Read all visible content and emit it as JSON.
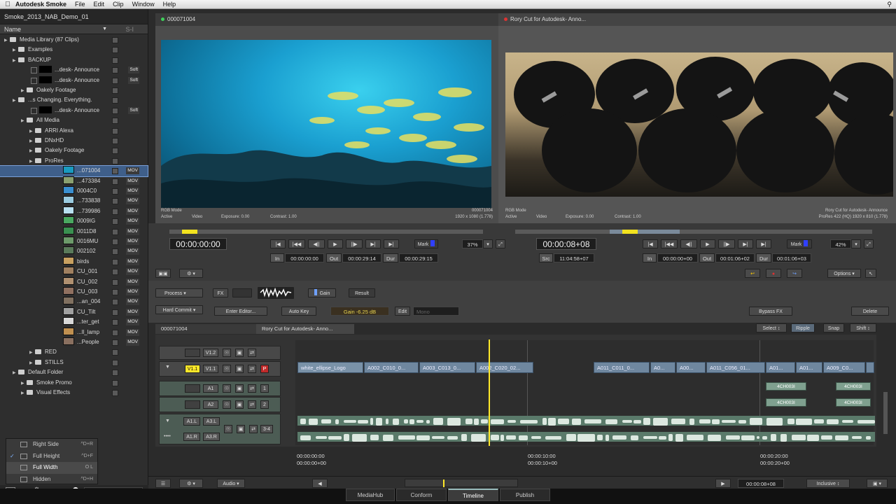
{
  "menubar": {
    "app": "Autodesk Smoke",
    "items": [
      "File",
      "Edit",
      "Clip",
      "Window",
      "Help"
    ]
  },
  "library": {
    "project_title": "Smoke_2013_NAB_Demo_01",
    "col_name": "Name",
    "col_si": "S-I",
    "rows": [
      {
        "label": "Media Library (87 Clips)",
        "indent": 0,
        "type": "root"
      },
      {
        "label": "Examples",
        "indent": 1,
        "type": "folder"
      },
      {
        "label": "BACKUP",
        "indent": 1,
        "type": "folder"
      },
      {
        "label": "...desk- Announce",
        "indent": 2,
        "type": "seq",
        "tag": "Soft"
      },
      {
        "label": "...desk- Announce",
        "indent": 2,
        "type": "seq",
        "tag": "Soft"
      },
      {
        "label": "Oakely Footage",
        "indent": 2,
        "type": "folder"
      },
      {
        "label": "...s Changing. Everything.",
        "indent": 1,
        "type": "folder"
      },
      {
        "label": "...desk- Announce",
        "indent": 2,
        "type": "seq",
        "tag": "Soft"
      },
      {
        "label": "All Media",
        "indent": 2,
        "type": "folder"
      },
      {
        "label": "ARRI Alexa",
        "indent": 3,
        "type": "folder"
      },
      {
        "label": "DNxHD",
        "indent": 3,
        "type": "folder"
      },
      {
        "label": "Oakely Footage",
        "indent": 3,
        "type": "folder"
      },
      {
        "label": "ProRes",
        "indent": 3,
        "type": "folder"
      },
      {
        "label": "...071004",
        "indent": 4,
        "type": "clip",
        "tag": "MOV",
        "color": "#1a9bc0",
        "selected": true
      },
      {
        "label": "...473384",
        "indent": 4,
        "type": "clip",
        "tag": "MOV",
        "color": "#8aa070"
      },
      {
        "label": "0004C0",
        "indent": 4,
        "type": "clip",
        "tag": "MOV",
        "color": "#3a8fd0"
      },
      {
        "label": "...733838",
        "indent": 4,
        "type": "clip",
        "tag": "MOV",
        "color": "#9acbe0"
      },
      {
        "label": "...739986",
        "indent": 4,
        "type": "clip",
        "tag": "MOV",
        "color": "#b8dff0"
      },
      {
        "label": "0009IG",
        "indent": 4,
        "type": "clip",
        "tag": "MOV",
        "color": "#4aa860"
      },
      {
        "label": "0011D8",
        "indent": 4,
        "type": "clip",
        "tag": "MOV",
        "color": "#3a9050"
      },
      {
        "label": "0016MU",
        "indent": 4,
        "type": "clip",
        "tag": "MOV",
        "color": "#6c9a6a"
      },
      {
        "label": "002102",
        "indent": 4,
        "type": "clip",
        "tag": "MOV",
        "color": "#5a7a5a"
      },
      {
        "label": "birds",
        "indent": 4,
        "type": "clip",
        "tag": "MOV",
        "color": "#c8a060"
      },
      {
        "label": "CU_001",
        "indent": 4,
        "type": "clip",
        "tag": "MOV",
        "color": "#a08060"
      },
      {
        "label": "CU_002",
        "indent": 4,
        "type": "clip",
        "tag": "MOV",
        "color": "#b09070"
      },
      {
        "label": "CU_003",
        "indent": 4,
        "type": "clip",
        "tag": "MOV",
        "color": "#907060"
      },
      {
        "label": "...an_004",
        "indent": 4,
        "type": "clip",
        "tag": "MOV",
        "color": "#807060"
      },
      {
        "label": "CU_Tilt",
        "indent": 4,
        "type": "clip",
        "tag": "MOV",
        "color": "#a0a0a0"
      },
      {
        "label": "...ter_get",
        "indent": 4,
        "type": "clip",
        "tag": "MOV",
        "color": "#d8d8d8"
      },
      {
        "label": "...ll_lamp",
        "indent": 4,
        "type": "clip",
        "tag": "MOV",
        "color": "#c09050"
      },
      {
        "label": "...People",
        "indent": 4,
        "type": "clip",
        "tag": "MOV",
        "color": "#8a7060"
      },
      {
        "label": "RED",
        "indent": 3,
        "type": "folder"
      },
      {
        "label": "STILLS",
        "indent": 3,
        "type": "folder"
      },
      {
        "label": "Default Folder",
        "indent": 1,
        "type": "folder"
      },
      {
        "label": "Smoke Promo",
        "indent": 2,
        "type": "folder"
      },
      {
        "label": "Visual Effects",
        "indent": 2,
        "type": "folder"
      }
    ]
  },
  "view_menu": [
    {
      "label": "Right Side",
      "shortcut": "^D+R"
    },
    {
      "label": "Full Height",
      "shortcut": "^D+F",
      "checked": true
    },
    {
      "label": "Full Width",
      "shortcut": "O L",
      "active": true
    },
    {
      "label": "Hidden",
      "shortcut": "^D+H"
    }
  ],
  "source_viewer": {
    "tab": "000071004",
    "meta_mode": "RGB Mode",
    "meta_active": "Active",
    "meta_video": "Video",
    "meta_exposure": "Exposure: 0.00",
    "meta_contrast": "Contrast: 1.00",
    "meta_name": "000071004",
    "meta_res": "1920 x 1080 (1.778)",
    "timecode": "00:00:00:00",
    "mark": "Mark",
    "zoom": "37%",
    "in_label": "In",
    "in_val": "00:00:00:00",
    "out_label": "Out",
    "out_val": "00:00:29:14",
    "dur_label": "Dur",
    "dur_val": "00:00:29:15",
    "scrub_pos": 0.04
  },
  "record_viewer": {
    "tab": "Rory Cut for Autodesk- Anno...",
    "meta_mode": "RGB Mode",
    "meta_active": "Active",
    "meta_video": "Video",
    "meta_exposure": "Exposure: 0.00",
    "meta_contrast": "Contrast: 1.00",
    "meta_name": "Rory Cut for Autodesk- Announce",
    "meta_res": "ProRes 422 (HQ) 1920 x 810 (1.778)",
    "timecode": "00:00:08+08",
    "mark": "Mark",
    "zoom": "42%",
    "src_label": "Src",
    "src_val": "11:04:58+07",
    "in_label": "In",
    "in_val": "00:00:00+00",
    "out_label": "Out",
    "out_val": "00:01:06+02",
    "dur_label": "Dur",
    "dur_val": "00:01:06+03",
    "scrub_pos": 0.3
  },
  "tools": {
    "options": "Options",
    "process": "Process",
    "fx": "FX",
    "gain": "Gain",
    "result": "Result",
    "hard_commit": "Hard Commit",
    "enter_editor": "Enter Editor...",
    "auto_key": "Auto Key",
    "gain_val": "Gain -6.25 dB",
    "edit": "Edit",
    "mono": "Mono",
    "bypass": "Bypass FX",
    "delete": "Delete"
  },
  "timeline": {
    "tab_source": "000071004",
    "tab_record": "Rory Cut for Autodesk- Anno...",
    "select": "Select",
    "ripple": "Ripple",
    "snap": "Snap",
    "shift": "Shift",
    "tracks": {
      "v12": "V1.2",
      "v11": "V1.1",
      "v11b": "V1.1",
      "p": "P",
      "a1": "A1",
      "a1n": "1",
      "a2": "A2",
      "a2n": "2",
      "a1l": "A1.L",
      "a3l": "A3.L",
      "a34": "3-4",
      "a1r": "A1.R",
      "a3r": "A3.R"
    },
    "video_clips": [
      "white_ellipse_Logo",
      "A002_C010_0...",
      "A003_C013_0...",
      "A002_C020_02...",
      "A011_C011_0...",
      "A0...",
      "A00...",
      "A011_C056_01...",
      "A01...",
      "A01...",
      "A009_C0..."
    ],
    "audio_clips": [
      "4CH003I",
      "4CH003I",
      "4CH003I",
      "4CH003I"
    ],
    "ruler": [
      {
        "a": "00:00:00:00",
        "b": "00:00:00+00"
      },
      {
        "a": "00:00:10:00",
        "b": "00:00:10+00"
      },
      {
        "a": "00:00:20:00",
        "b": "00:00:20+00"
      }
    ]
  },
  "bottom": {
    "audio": "Audio",
    "timecode": "00:00:08+08",
    "inclusive": "Inclusive",
    "tabs": [
      "MediaHub",
      "Conform",
      "Timeline",
      "Publish"
    ],
    "active_tab": "Timeline"
  }
}
